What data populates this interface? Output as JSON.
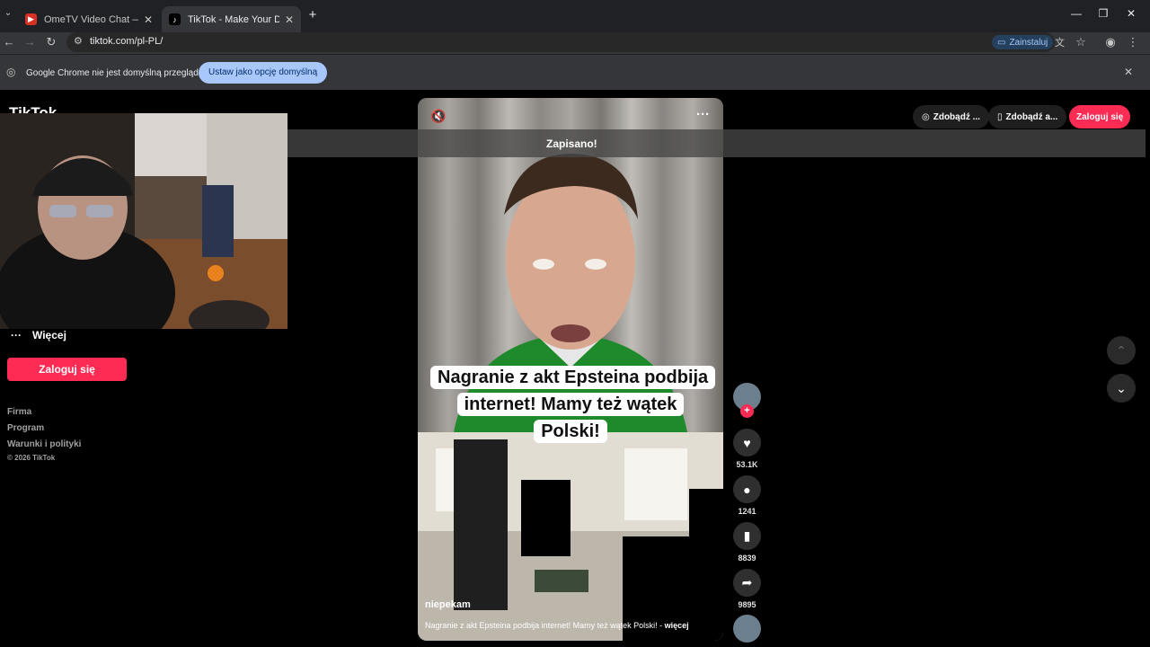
{
  "browser": {
    "tabs": [
      {
        "title": "OmeTV Video Chat — Omegle",
        "active": false
      },
      {
        "title": "TikTok - Make Your Day",
        "active": true
      }
    ],
    "new_tab": "+",
    "url": "tiktok.com/pl-PL/",
    "install_label": "Zainstaluj",
    "infobar_text": "Google Chrome nie jest domyślną przeglądarką",
    "infobar_button": "Ustaw jako opcję domyślną"
  },
  "tiktok": {
    "logo": "TikTok",
    "more_label": "Więcej",
    "login_label": "Zaloguj się",
    "footer": [
      "Firma",
      "Program",
      "Warunki i polityki",
      "© 2026 TikTok"
    ],
    "top_buttons": [
      "Zdobądź ...",
      "Zdobądź a..."
    ],
    "top_login": "Zaloguj się",
    "saved_toast": "Zapisano!",
    "video": {
      "caption_overlay": "Nagranie z akt Epsteina podbija internet! Mamy też wątek Polski!",
      "author": "niepekam",
      "description": "Nagranie z akt Epsteina podbija internet! Mamy też wątek Polski! -",
      "more_link": "więcej"
    },
    "actions": {
      "likes": "53.1K",
      "comments": "1241",
      "saves": "8839",
      "shares": "9895"
    }
  },
  "colors": {
    "accent": "#fe2c55",
    "chrome_dark": "#202124"
  }
}
